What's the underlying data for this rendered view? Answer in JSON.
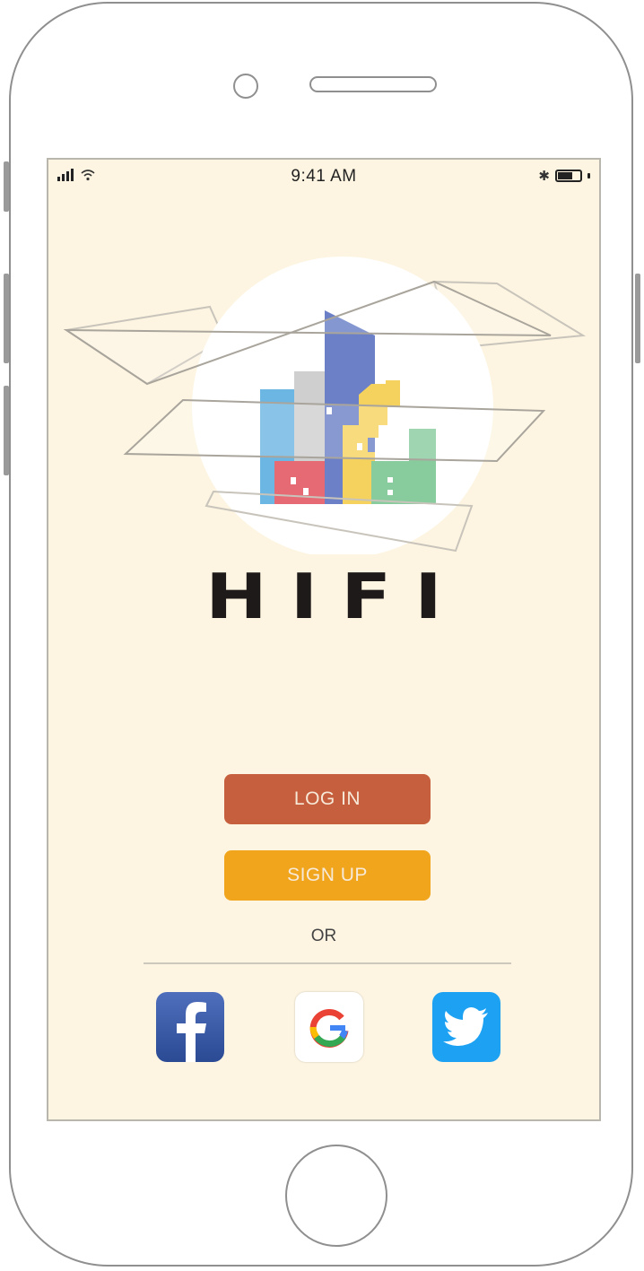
{
  "status_bar": {
    "time": "9:41 AM"
  },
  "brand": {
    "name": "HIFI"
  },
  "auth": {
    "login_label": "LOG IN",
    "signup_label": "SIGN UP",
    "or_label": "OR"
  },
  "social": [
    {
      "name": "facebook",
      "icon": "facebook-icon",
      "color": "#3b5998"
    },
    {
      "name": "google",
      "icon": "google-icon",
      "color": "#ffffff"
    },
    {
      "name": "twitter",
      "icon": "twitter-icon",
      "color": "#1da1f2"
    }
  ],
  "colors": {
    "screen_bg": "#fdf5e1",
    "login": "#c55f3e",
    "signup": "#f0a51c"
  }
}
